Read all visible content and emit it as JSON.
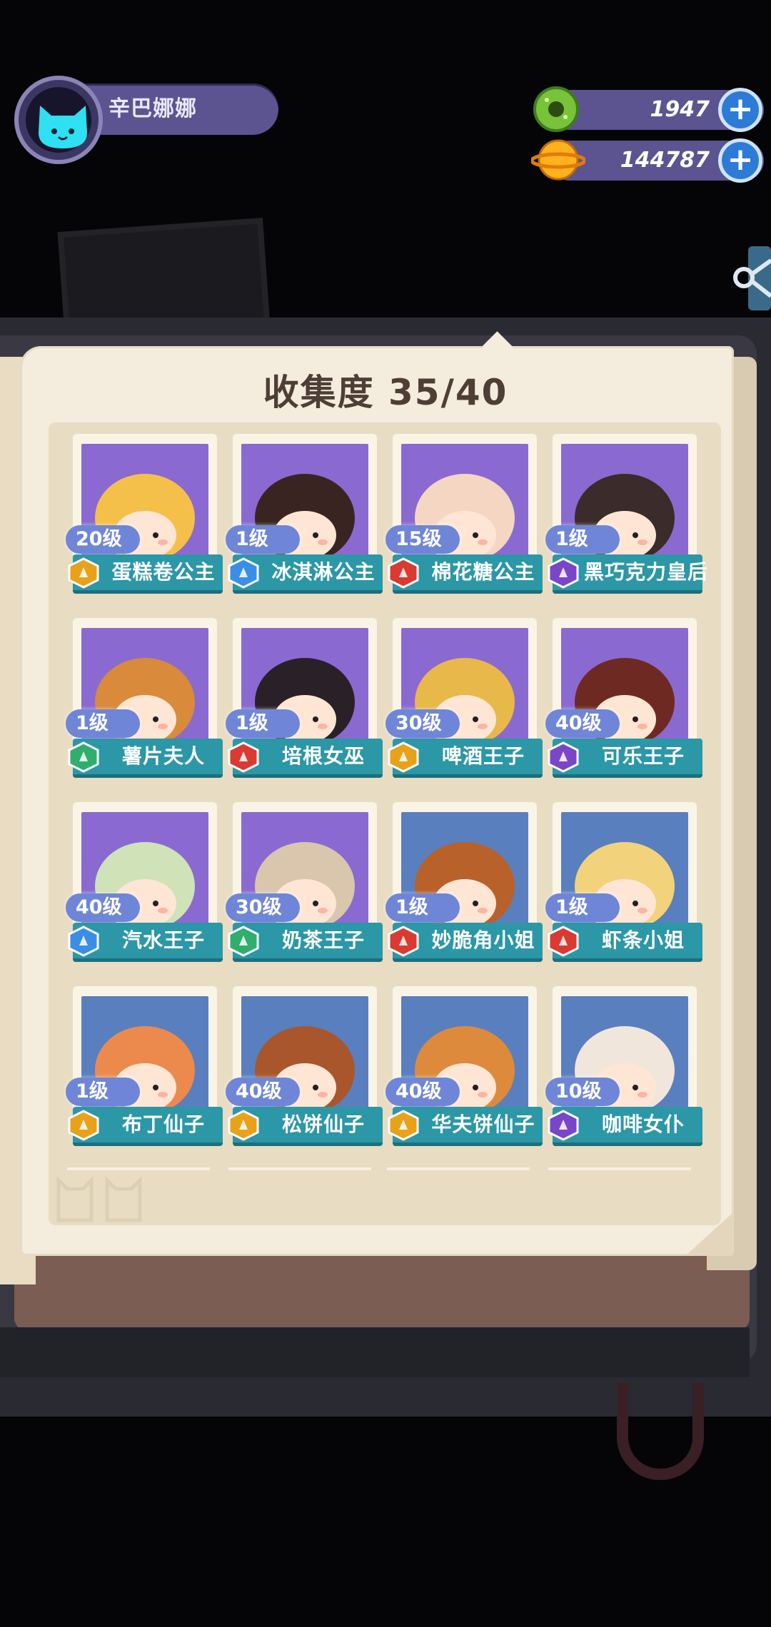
{
  "player": {
    "name": "辛巴娜娜"
  },
  "currencies": [
    {
      "icon": "green-donut-icon",
      "value": "1947",
      "plus": "+"
    },
    {
      "icon": "orange-planet-coin-icon",
      "value": "144787",
      "plus": "+"
    }
  ],
  "collection": {
    "title": "收集度 35/40"
  },
  "colors": {
    "purple_bg": "#8a6ad0",
    "blue_bg": "#5a7fbe",
    "badge_gold": "#e8a21a",
    "badge_blue": "#3a8ee6",
    "badge_red": "#d93a32",
    "badge_purple": "#7a46c8",
    "badge_green": "#2fae6e",
    "name_banner": "#2c97a6"
  },
  "cards": [
    {
      "level": "20级",
      "name": "蛋糕卷公主",
      "badge": "gold",
      "bg": "purple"
    },
    {
      "level": "1级",
      "name": "冰淇淋公主",
      "badge": "blue",
      "bg": "purple"
    },
    {
      "level": "15级",
      "name": "棉花糖公主",
      "badge": "red",
      "bg": "purple"
    },
    {
      "level": "1级",
      "name": "黑巧克力皇后",
      "badge": "purple",
      "bg": "purple"
    },
    {
      "level": "1级",
      "name": "薯片夫人",
      "badge": "green",
      "bg": "purple"
    },
    {
      "level": "1级",
      "name": "培根女巫",
      "badge": "red",
      "bg": "purple"
    },
    {
      "level": "30级",
      "name": "啤酒王子",
      "badge": "gold",
      "bg": "purple"
    },
    {
      "level": "40级",
      "name": "可乐王子",
      "badge": "purple",
      "bg": "purple"
    },
    {
      "level": "40级",
      "name": "汽水王子",
      "badge": "blue",
      "bg": "purple"
    },
    {
      "level": "30级",
      "name": "奶茶王子",
      "badge": "green",
      "bg": "purple"
    },
    {
      "level": "1级",
      "name": "妙脆角小姐",
      "badge": "red",
      "bg": "blue"
    },
    {
      "level": "1级",
      "name": "虾条小姐",
      "badge": "red",
      "bg": "blue"
    },
    {
      "level": "1级",
      "name": "布丁仙子",
      "badge": "gold",
      "bg": "blue"
    },
    {
      "level": "40级",
      "name": "松饼仙子",
      "badge": "gold",
      "bg": "blue"
    },
    {
      "level": "40级",
      "name": "华夫饼仙子",
      "badge": "gold",
      "bg": "blue"
    },
    {
      "level": "10级",
      "name": "咖啡女仆",
      "badge": "purple",
      "bg": "blue"
    }
  ]
}
